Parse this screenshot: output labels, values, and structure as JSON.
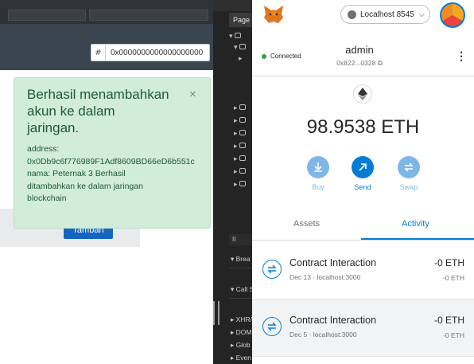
{
  "web_app": {
    "hash_input": {
      "prefix": "#",
      "value": "0x0000000000000000000"
    },
    "add_button_label": "Tambah",
    "toast": {
      "title": "Berhasil menambahkan akun ke dalam jaringan.",
      "close": "×",
      "address_line": "address:",
      "address_value": "0x0Db9c6f776989F1Adf8609BD66eD6b551c",
      "name_line": "nama: Peternak 3 Berhasil",
      "msg_line1": "ditambahkan ke dalam jaringan",
      "msg_line2": "blockchain"
    }
  },
  "devtools": {
    "page_tab": "Page",
    "panels": [
      "Brea",
      "Call S",
      "XHR/",
      "DOM",
      "Glob",
      "Even"
    ],
    "pause_label": "II"
  },
  "metamask": {
    "network": "Localhost 8545",
    "account": {
      "status": "Connected",
      "name": "admin",
      "address_short": "0x822...0328"
    },
    "balance": "98.9538 ETH",
    "actions": [
      {
        "label": "Buy",
        "icon": "download-icon"
      },
      {
        "label": "Send",
        "icon": "arrow-up-right-icon"
      },
      {
        "label": "Swap",
        "icon": "swap-icon"
      }
    ],
    "tabs": {
      "assets": "Assets",
      "activity": "Activity"
    },
    "transactions": [
      {
        "title": "Contract Interaction",
        "subtitle": "Dec 13 · localhost:3000",
        "amount": "-0 ETH",
        "amount_secondary": "-0 ETH"
      },
      {
        "title": "Contract Interaction",
        "subtitle": "Dec 5 · localhost:3000",
        "amount": "-0 ETH",
        "amount_secondary": "-0 ETH"
      }
    ],
    "colors": {
      "accent": "#037dd6",
      "toast_bg": "#d1ecd9",
      "toast_text": "#1d5a33",
      "connected": "#28a745"
    }
  }
}
